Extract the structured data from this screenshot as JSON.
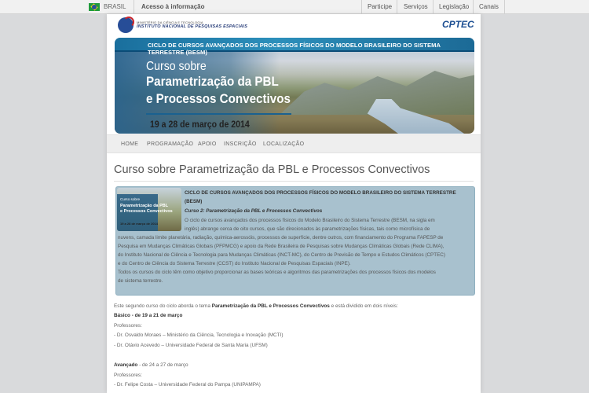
{
  "govbar": {
    "country": "BRASIL",
    "access": "Acesso à informação",
    "links": [
      "Participe",
      "Serviços",
      "Legislação",
      "Canais"
    ]
  },
  "header": {
    "ministry": "MINISTÉRIO DA CIÊNCIA E TECNOLOGIA",
    "institute": "INSTITUTO NACIONAL DE PESQUISAS ESPACIAIS",
    "partner": "CPTEC"
  },
  "banner": {
    "top_title": "CICLO DE CURSOS AVANÇADOS DOS PROCESSOS FÍSICOS DO MODELO BRASILEIRO DO SISTEMA TERRESTRE (BESM)",
    "line1": "Curso sobre",
    "line2": "Parametrização da PBL",
    "line3": "e Processos Convectivos",
    "date": "19 a 28 de março de 2014"
  },
  "nav": {
    "items": [
      "HOME",
      "PROGRAMAÇÃO",
      "APOIO",
      "INSCRIÇÃO",
      "LOCALIZAÇÃO"
    ]
  },
  "page_title": "Curso sobre Parametrização da PBL e Processos Convectivos",
  "intro": {
    "thumb": {
      "line1": "Curso sobre",
      "line2": "Parametrização da PBL",
      "line3": "e Processos Convectivos",
      "date": "19 a 28 de março de 2014"
    },
    "heading": "CICLO DE CURSOS AVANÇADOS DOS PROCESSOS FÍSICOS DO MODELO BRASILEIRO DO SISTEMA TERRESTRE",
    "heading2": "(BESM)",
    "subheading": "Curso 2: Parametrização da PBL e Processos Convectivos",
    "lines": [
      "O ciclo de cursos avançados dos processos físicos do Modelo Brasileiro do Sistema Terrestre (BESM, na sigla em",
      "inglês) abrange cerca de oito cursos, que são direcionados às parametrizações físicas, tais como microfísica de",
      "nuvens, camada limite planetária, radiação, química-aerossóis, processos de superfície, dentre outros, com financiamento do Programa FAPESP de",
      "Pesquisa em Mudanças Climáticas Globais (PFPMCG) e apoio da Rede Brasileira de Pesquisas sobre Mudanças Climáticas Globais (Rede CLIMA),",
      "do Instituto Nacional de Ciência e Tecnologia para Mudanças Climáticas (INCT-MC), do Centro de Previsão de Tempo e Estudos Climáticos (CPTEC)",
      "e do Centro de Ciência do Sistema Terrestre (CCST) do Instituto Nacional de Pesquisas Espaciais (INPE).",
      "Todos os cursos do ciclo têm como objetivo proporcionar as bases teóricas e algoritmos das parametrizações dos processos físicos dos modelos",
      "de sistema terrestre."
    ]
  },
  "body": {
    "theme_pre": "Este segundo curso do ciclo aborda o tema ",
    "theme_bold": "Parametrização da PBL e Processos Convectivos",
    "theme_post": " e está dividido em dois níveis:",
    "basic_label": "Básico",
    "basic_dates": " - de 19 a 21 de março",
    "professors_label": "Professores:",
    "basic_profs": [
      "- Dr. Osvaldo Moraes – Ministério da Ciência, Tecnologia e Inovação (MCTI)",
      "- Dr. Otávio Acevedo – Universidade Federal de Santa Maria (UFSM)"
    ],
    "advanced_label": "Avançado",
    "advanced_dates": " - de 24 a 27 de março",
    "professors_label2": "Professores:",
    "advanced_profs": [
      "- Dr. Felipe Costa – Universidade Federal do Pampa (UNIPAMPA)"
    ]
  }
}
